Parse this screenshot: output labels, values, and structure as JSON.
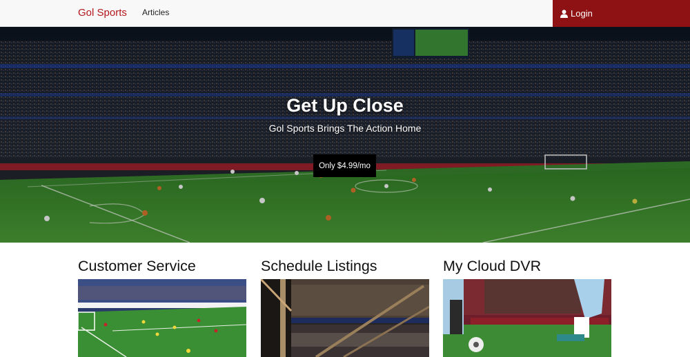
{
  "nav": {
    "brand": "Gol Sports",
    "links": [
      "Articles"
    ],
    "login_label": "Login"
  },
  "hero": {
    "title": "Get Up Close",
    "subtitle": "Gol Sports Brings The Action Home",
    "cta_label": "Only $4.99/mo"
  },
  "features": [
    {
      "title": "Customer Service"
    },
    {
      "title": "Schedule Listings"
    },
    {
      "title": "My Cloud DVR"
    }
  ],
  "colors": {
    "brand": "#b4161b",
    "login_bg": "#8e1213",
    "cta_bg": "#000000",
    "pitch": "#3f8a2c"
  },
  "icons": {
    "login": "user-icon"
  }
}
